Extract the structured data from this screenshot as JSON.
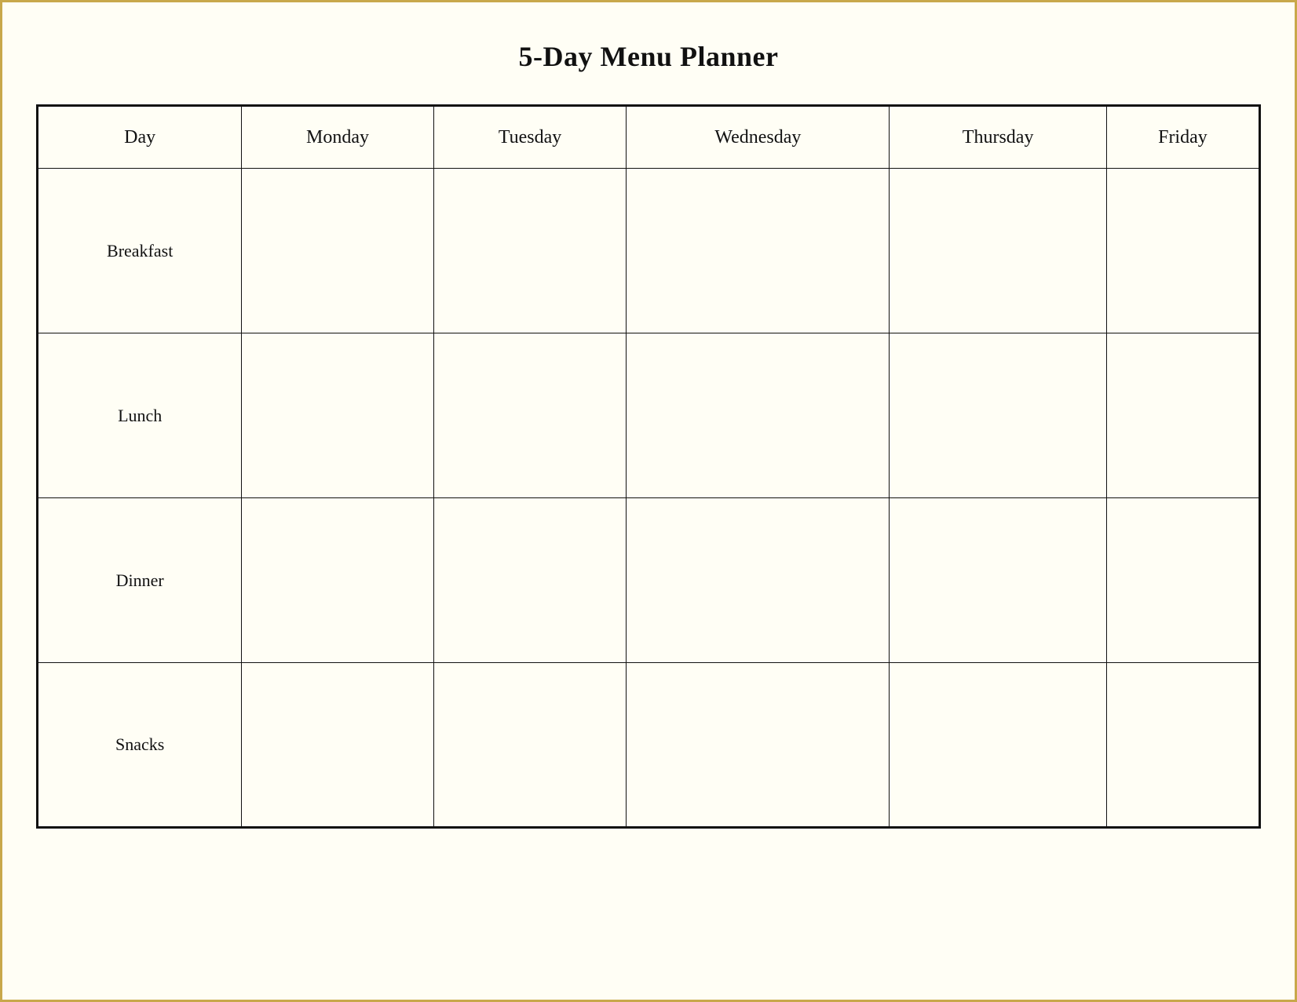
{
  "page": {
    "title": "5-Day Menu Planner"
  },
  "table": {
    "columns": [
      {
        "id": "day",
        "label": "Day"
      },
      {
        "id": "monday",
        "label": "Monday"
      },
      {
        "id": "tuesday",
        "label": "Tuesday"
      },
      {
        "id": "wednesday",
        "label": "Wednesday"
      },
      {
        "id": "thursday",
        "label": "Thursday"
      },
      {
        "id": "friday",
        "label": "Friday"
      }
    ],
    "rows": [
      {
        "label": "Breakfast"
      },
      {
        "label": "Lunch"
      },
      {
        "label": "Dinner"
      },
      {
        "label": "Snacks"
      }
    ]
  }
}
